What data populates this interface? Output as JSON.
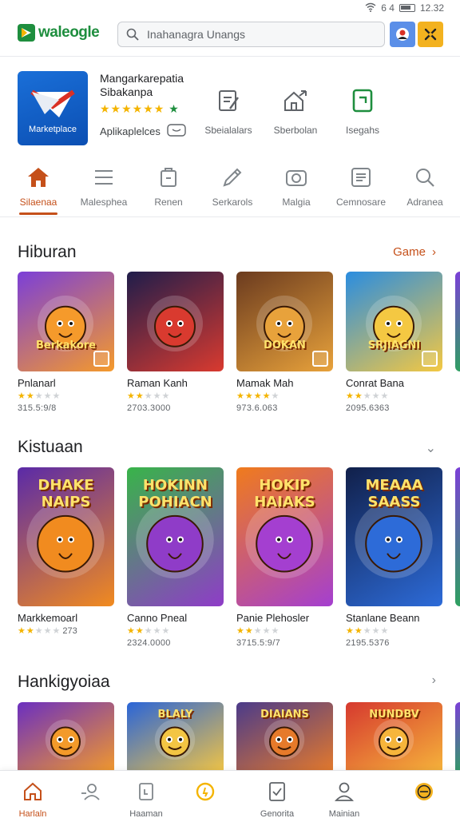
{
  "status": {
    "time": "12.32",
    "signal": "6 4"
  },
  "header": {
    "logo_text": "waleogle",
    "search_placeholder": "Inahanagra Unangs"
  },
  "featured_app": {
    "title_line1": "Mangarkarepatia",
    "title_line2": "Sibakanpa",
    "icon_label": "Marketplace",
    "rating_stars": "★★★★★★",
    "rating_extra": "★",
    "category": "Aplikaplelces",
    "actions": [
      {
        "label": "Sbeialalars",
        "icon": "document-edit-icon"
      },
      {
        "label": "Sberbolan",
        "icon": "home-share-icon"
      },
      {
        "label": "Isegahs",
        "icon": "green-doc-icon"
      }
    ]
  },
  "category_tabs": [
    {
      "label": "Silaenaa",
      "icon": "home-icon",
      "active": true
    },
    {
      "label": "Malesphea",
      "icon": "menu-icon",
      "active": false
    },
    {
      "label": "Renen",
      "icon": "box-icon",
      "active": false
    },
    {
      "label": "Serkarols",
      "icon": "pen-icon",
      "active": false
    },
    {
      "label": "Malgia",
      "icon": "camera-icon",
      "active": false
    },
    {
      "label": "Cemnosare",
      "icon": "list-icon",
      "active": false
    },
    {
      "label": "Adranea",
      "icon": "search-icon",
      "active": false
    }
  ],
  "sections": [
    {
      "title": "Hiburan",
      "link": "Game",
      "items": [
        {
          "name": "Pnlanarl",
          "stars_on": 2,
          "count": "315.5:9/8",
          "art_text": "Berkakore",
          "palette": [
            "#7b3fd8",
            "#f59a2b"
          ]
        },
        {
          "name": "Raman Kanh",
          "stars_on": 2,
          "count": "2703.3000",
          "art_text": "",
          "palette": [
            "#1f1d4b",
            "#d93a2f"
          ]
        },
        {
          "name": "Mamak Mah",
          "stars_on": 4,
          "count": "973.6.063",
          "art_text": "DOKAN",
          "palette": [
            "#6b3b1f",
            "#e8a23b"
          ]
        },
        {
          "name": "Conrat Bana",
          "stars_on": 2,
          "count": "2095.6363",
          "art_text": "SRJIAGNI",
          "palette": [
            "#2a8de0",
            "#f4c842"
          ]
        }
      ]
    },
    {
      "title": "Kistuaan",
      "link": "",
      "items": [
        {
          "name": "Markkemoarl",
          "stars_on": 2,
          "count": "",
          "rating_text": "273",
          "art_text": "DHAKE NAIPS",
          "palette": [
            "#5a2aa8",
            "#f18b1f"
          ]
        },
        {
          "name": "Canno Pneal",
          "stars_on": 2,
          "count": "2324.0000",
          "art_text": "HOKINN POHIACN",
          "palette": [
            "#38b449",
            "#8f3cc8"
          ]
        },
        {
          "name": "Panie Plehosler",
          "stars_on": 2,
          "count": "3715.5:9/7",
          "art_text": "HOKIP HAIAKS",
          "palette": [
            "#f07b1c",
            "#a43fd0"
          ]
        },
        {
          "name": "Stanlane Beann",
          "stars_on": 2,
          "count": "2195.5376",
          "art_text": "MEAAA SAASS",
          "palette": [
            "#11204a",
            "#2d6bd8"
          ]
        }
      ]
    },
    {
      "title": "Hankigyoiaa",
      "link": "",
      "items": [
        {
          "name": "",
          "stars_on": 0,
          "count": "",
          "art_text": "",
          "palette": [
            "#6b2fc0",
            "#f39a2a"
          ]
        },
        {
          "name": "",
          "stars_on": 0,
          "count": "",
          "art_text": "BLALY",
          "palette": [
            "#2a65d8",
            "#f3c543"
          ]
        },
        {
          "name": "",
          "stars_on": 0,
          "count": "",
          "art_text": "DIAIANS",
          "palette": [
            "#4b3b8a",
            "#e67a2a"
          ]
        },
        {
          "name": "",
          "stars_on": 0,
          "count": "",
          "art_text": "NUNDBV",
          "palette": [
            "#d6392f",
            "#f6b53b"
          ]
        }
      ]
    }
  ],
  "bottom_nav": [
    {
      "label": "Harlaln",
      "icon": "home-icon",
      "active": true
    },
    {
      "label": "",
      "icon": "people-icon",
      "active": false
    },
    {
      "label": "Haaman",
      "icon": "box-icon",
      "active": false
    },
    {
      "label": "",
      "icon": "coin-icon",
      "active": false
    },
    {
      "label": "Genorita",
      "icon": "document-check-icon",
      "active": false
    },
    {
      "label": "Mainian",
      "icon": "person-icon",
      "active": false
    },
    {
      "label": "",
      "icon": "coin-orange-icon",
      "active": false
    }
  ],
  "colors": {
    "accent": "#c5501a",
    "brand_green": "#1e8e3e",
    "star": "#f4b400"
  }
}
